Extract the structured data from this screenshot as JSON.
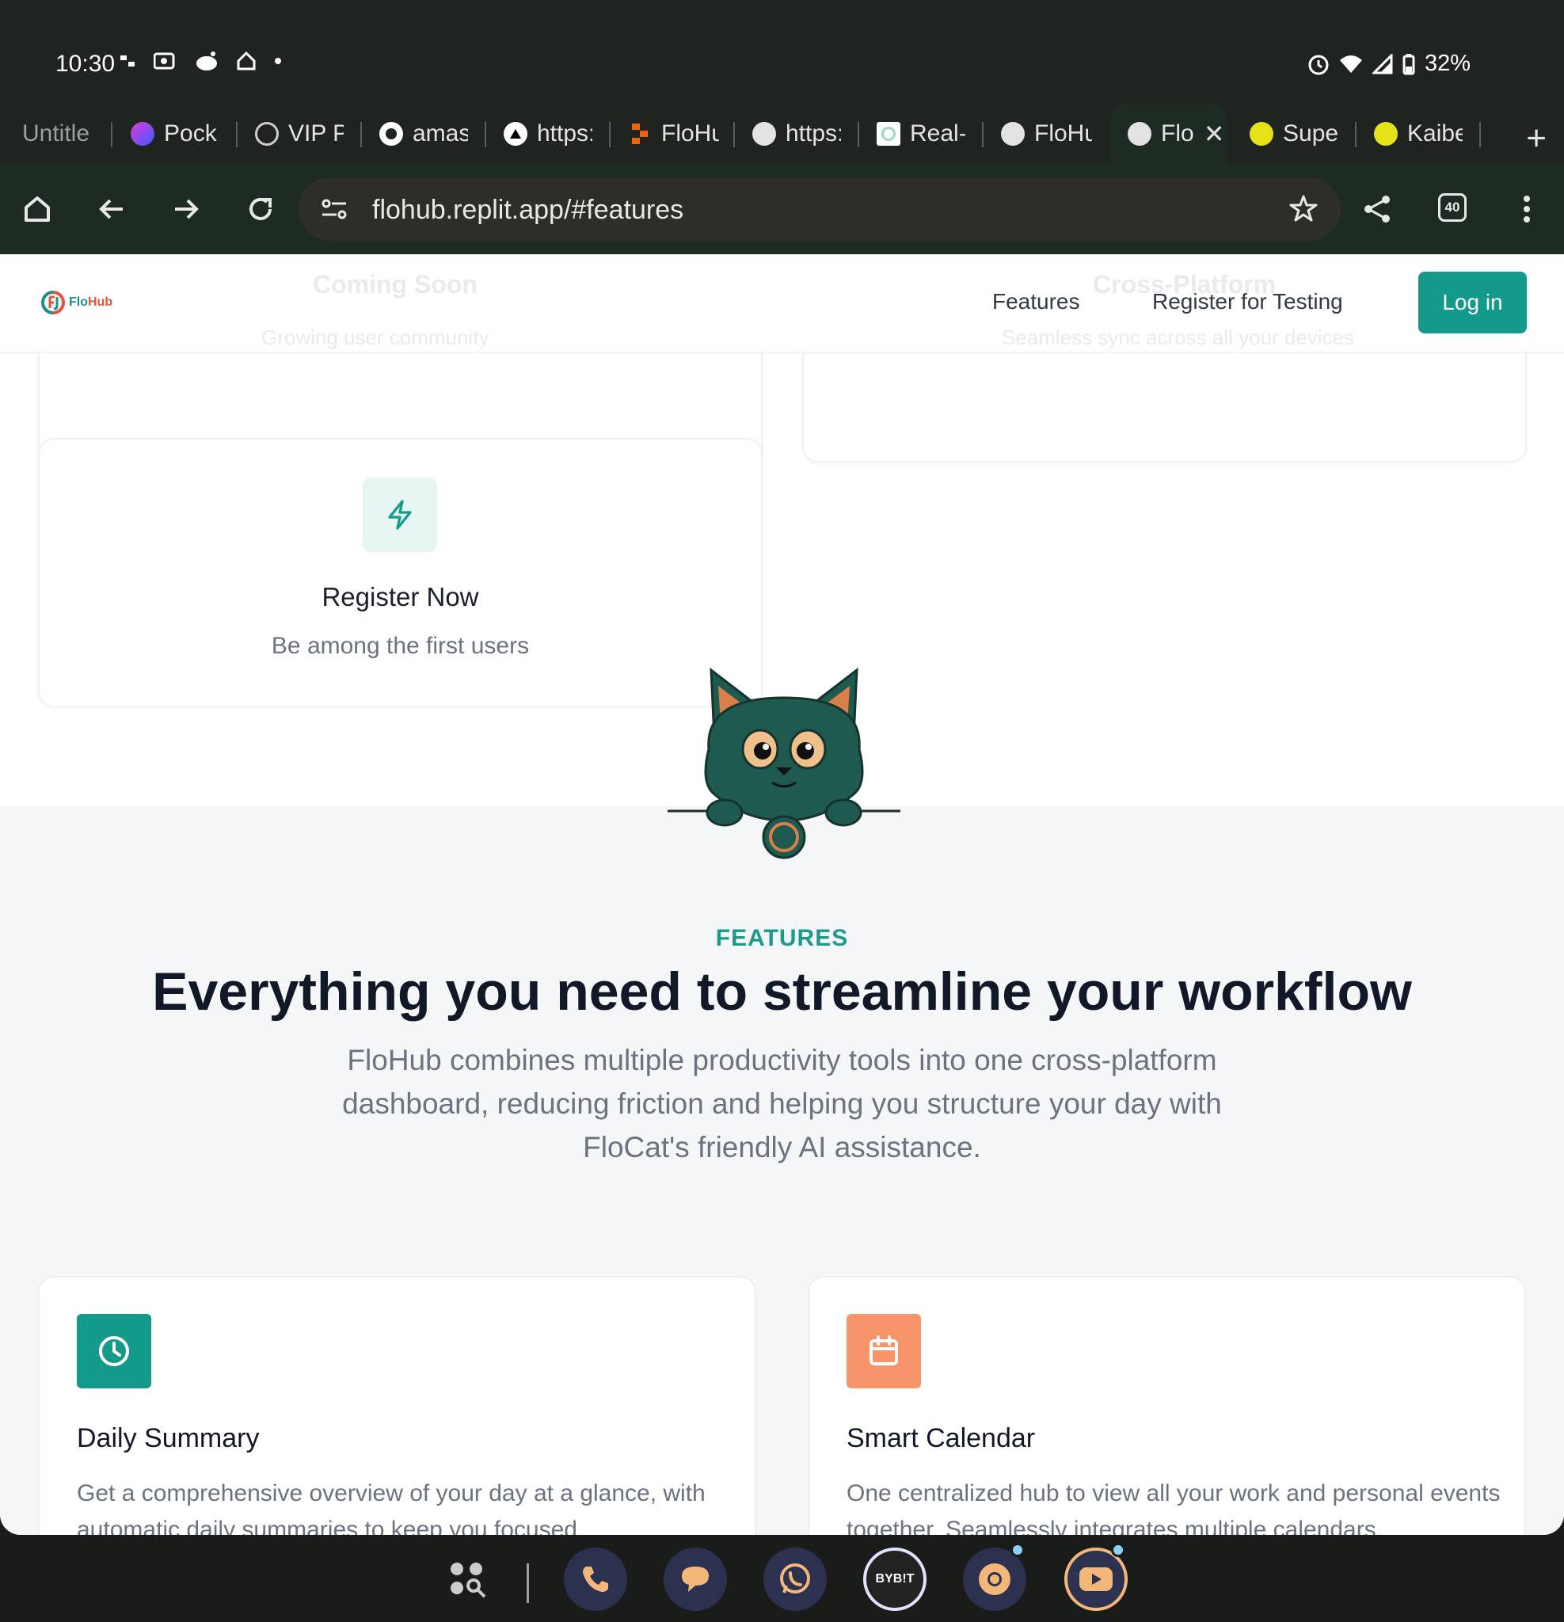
{
  "status_bar": {
    "time": "10:30",
    "battery": "32%",
    "icons": [
      "vpn-key-icon",
      "photo-icon",
      "reddit-icon",
      "home-icon",
      "dot-icon",
      "alarm-icon",
      "wifi-icon",
      "signal-icon",
      "battery-icon"
    ]
  },
  "tabs": [
    {
      "title": "Untitle",
      "favicon": "document-icon"
    },
    {
      "title": "Pocke",
      "favicon": "pocket-icon"
    },
    {
      "title": "VIP Pa",
      "favicon": "vip-icon"
    },
    {
      "title": "amase",
      "favicon": "github-icon"
    },
    {
      "title": "https:",
      "favicon": "triangle-icon"
    },
    {
      "title": "FloHu",
      "favicon": "replit-icon"
    },
    {
      "title": "https:",
      "favicon": "globe-icon"
    },
    {
      "title": "Real-l",
      "favicon": "ring-icon"
    },
    {
      "title": "FloHu",
      "favicon": "globe-icon"
    },
    {
      "title": "Flo",
      "favicon": "globe-icon",
      "active": true
    },
    {
      "title": "Super",
      "favicon": "smiley-icon"
    },
    {
      "title": "Kaibe",
      "favicon": "smiley-icon"
    }
  ],
  "toolbar": {
    "url": "flohub.replit.app/#features",
    "tab_count": "40"
  },
  "site": {
    "logo_text_flo": "Flo",
    "logo_text_hub": "Hub",
    "nav": {
      "features": "Features",
      "register": "Register for Testing",
      "login": "Log in"
    },
    "ghost": {
      "left_title": "Coming Soon",
      "left_sub": "Growing user community",
      "right_title": "Cross-Platform",
      "right_sub": "Seamless sync across all your devices"
    },
    "register_card": {
      "title": "Register Now",
      "subtitle": "Be among the first users"
    },
    "features": {
      "eyebrow": "FEATURES",
      "heading": "Everything you need to streamline your workflow",
      "description": "FloHub combines multiple productivity tools into one cross-platform dashboard, reducing friction and helping you structure your day with FloCat's friendly AI assistance."
    },
    "feature_cards": [
      {
        "title": "Daily Summary",
        "description": "Get a comprehensive overview of your day at a glance, with automatic daily summaries to keep you focused.",
        "icon": "clock-icon",
        "color": "#149a8a"
      },
      {
        "title": "Smart Calendar",
        "description": "One centralized hub to view all your work and personal events together. Seamlessly integrates multiple calendars.",
        "icon": "calendar-icon",
        "color": "#f7946a"
      }
    ]
  },
  "colors": {
    "accent": "#149a8a",
    "browser_chrome": "#1d2b23",
    "heading": "#111827",
    "muted": "#6b7280"
  },
  "dock": [
    "app-drawer-icon",
    "phone-icon",
    "messages-icon",
    "whatsapp-icon",
    "bybit-icon",
    "chrome-icon",
    "youtube-icon"
  ],
  "dock_labels": {
    "bybit": "BYB!T"
  }
}
